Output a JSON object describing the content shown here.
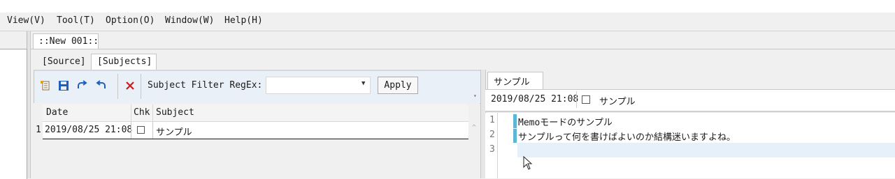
{
  "menubar": {
    "items": [
      "View(V)",
      "Tool(T)",
      "Option(O)",
      "Window(W)",
      "Help(H)"
    ]
  },
  "document_tab": {
    "label": "::New 001::"
  },
  "view_tabs": {
    "source": "[Source]",
    "subjects": "[Subjects]"
  },
  "toolbar": {
    "icons": [
      "new-note-icon",
      "save-icon",
      "redo-icon",
      "undo-icon",
      "delete-icon"
    ],
    "filter_label": "Subject Filter RegEx:",
    "filter_value": "",
    "apply_label": "Apply"
  },
  "subjects_table": {
    "columns": [
      "Date",
      "Chk",
      "Subject"
    ],
    "rows": [
      {
        "num": "1",
        "date": "2019/08/25 21:08",
        "checked": false,
        "subject": "サンプル"
      }
    ]
  },
  "detail": {
    "tab_label": "サンプル",
    "date": "2019/08/25 21:08",
    "checked": false,
    "subject": "サンプル"
  },
  "editor": {
    "line_numbers": [
      "1",
      "2",
      "3"
    ],
    "lines": [
      "Memoモードのサンプル",
      "サンプルって何を書けばよいのか結構迷いますよね。",
      ""
    ]
  },
  "colors": {
    "accent_blue": "#1f5fbf",
    "delete_red": "#d01818",
    "change_mark": "#5cb6d6",
    "toolbar_bg": "#eaf0f8"
  }
}
